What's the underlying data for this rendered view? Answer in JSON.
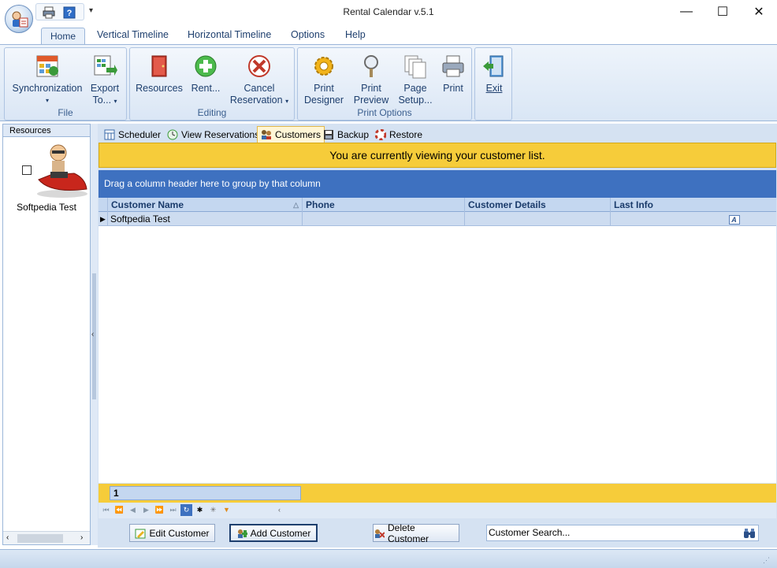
{
  "window": {
    "title": "Rental Calendar v.5.1",
    "controls": {
      "minimize": "—",
      "maximize": "☐",
      "close": "✕"
    }
  },
  "qat": {
    "dropdown": "▾"
  },
  "ribbon": {
    "tabs": [
      "Home",
      "Vertical Timeline",
      "Horizontal Timeline",
      "Options",
      "Help"
    ],
    "active_tab": "Home",
    "groups": {
      "file": {
        "label": "File",
        "sync_label": "Synchronization",
        "export_label1": "Export",
        "export_label2": "To..."
      },
      "editing": {
        "label": "Editing",
        "resources_label": "Resources",
        "rent_label": "Rent...",
        "cancel_label1": "Cancel",
        "cancel_label2": "Reservation"
      },
      "print_options": {
        "label": "Print Options",
        "designer_label1": "Print",
        "designer_label2": "Designer",
        "preview_label1": "Print",
        "preview_label2": "Preview",
        "pagesetup_label1": "Page",
        "pagesetup_label2": "Setup...",
        "print_label": "Print"
      },
      "exit": {
        "exit_label": "Exit"
      }
    }
  },
  "left_panel": {
    "header": "Resources",
    "resource_name": "Softpedia Test"
  },
  "main_tabs": [
    "Scheduler",
    "View Reservations",
    "Customers",
    "Backup",
    "Restore"
  ],
  "active_main_tab": "Customers",
  "banner": "You are currently viewing your customer list.",
  "group_hint": "Drag a column header here to group by that column",
  "grid": {
    "columns": [
      "Customer Name",
      "Phone",
      "Customer Details",
      "Last Info"
    ],
    "rows": [
      {
        "customer_name": "Softpedia Test",
        "phone": "",
        "details": "",
        "last_info": "A"
      }
    ],
    "footer_count": "1"
  },
  "bottom": {
    "edit_label": "Edit Customer",
    "add_label": "Add Customer",
    "delete_label": "Delete Customer",
    "search_value": "Customer Search..."
  },
  "colors": {
    "accent": "#3e71c0",
    "banner": "#f6cc3a",
    "ribbon": "#dae6f5"
  }
}
